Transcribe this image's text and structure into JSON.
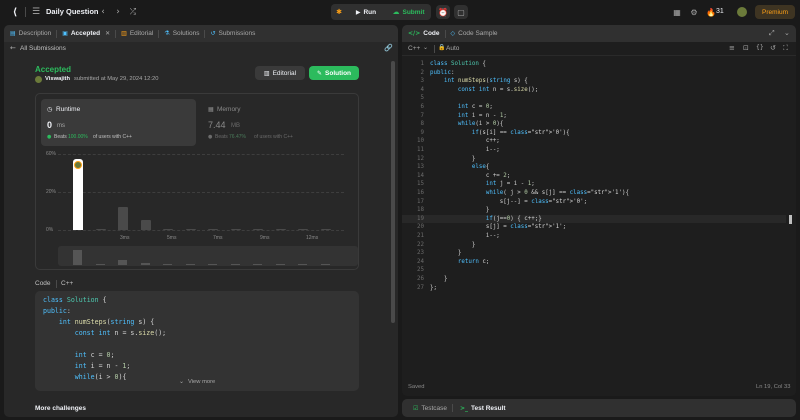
{
  "header": {
    "title": "Daily Question",
    "run_label": "Run",
    "submit_label": "Submit",
    "streak": "31",
    "premium_label": "Premium"
  },
  "left": {
    "tabs": [
      "Description",
      "Accepted",
      "Editorial",
      "Solutions",
      "Submissions"
    ],
    "back_label": "All Submissions",
    "status": "Accepted",
    "username": "Viswajith",
    "submitted": "submitted at May 29, 2024 12:20",
    "editorial_btn": "Editorial",
    "solution_btn": "Solution",
    "runtime": {
      "label": "Runtime",
      "value": "0",
      "unit": "ms",
      "beats_prefix": "Beats",
      "beats_pct": "100.00%",
      "beats_suffix": "of users with C++"
    },
    "memory": {
      "label": "Memory",
      "value": "7.44",
      "unit": "MB",
      "beats_prefix": "Beats",
      "beats_pct": "76.47%",
      "beats_suffix": "of users with C++"
    },
    "code_label": "Code",
    "code_lang": "C++",
    "code_preview": [
      "class Solution {",
      "public:",
      "    int numSteps(string s) {",
      "        const int n = s.size();",
      "",
      "        int c = 0;",
      "        int i = n - 1;",
      "        while(i > 0){"
    ],
    "view_more": "View more",
    "more_challenges": "More challenges"
  },
  "chart_data": {
    "type": "bar",
    "y_ticks": [
      "60%",
      "20%",
      "0%"
    ],
    "x_labels": [
      "3ms",
      "5ms",
      "7ms",
      "9ms",
      "12ms"
    ],
    "values": [
      56,
      0.5,
      18,
      8,
      0.5,
      0.5,
      0.5,
      0.5,
      0.5,
      0.5,
      0.5,
      0.5
    ],
    "ylim": [
      0,
      60
    ],
    "highlight_index": 0,
    "grid": true
  },
  "editor": {
    "tabs": [
      "Code",
      "Code Sample"
    ],
    "lang": "C++",
    "mode": "Auto",
    "status_left": "Saved",
    "status_right": "Ln 19, Col 33",
    "code": [
      "class Solution {",
      "public:",
      "    int numSteps(string s) {",
      "        const int n = s.size();",
      "",
      "        int c = 0;",
      "        int i = n - 1;",
      "        while(i > 0){",
      "            if(s[i] == '0'){",
      "                c++;",
      "                i--;",
      "            }",
      "            else{",
      "                c += 2;",
      "                int j = i - 1;",
      "                while( j > 0 && s[j] == '1'){",
      "                    s[j--] = '0';",
      "                }",
      "                if(j==0) { c++;}",
      "                s[j] = '1';",
      "                i--;",
      "            }",
      "        }",
      "        return c;",
      "",
      "    }",
      "};"
    ]
  },
  "bottom": {
    "testcase": "Testcase",
    "test_result": "Test Result"
  },
  "colors": {
    "accent_green": "#2cbb5d",
    "orange": "#ffa116",
    "blue": "#4fc1ff"
  }
}
